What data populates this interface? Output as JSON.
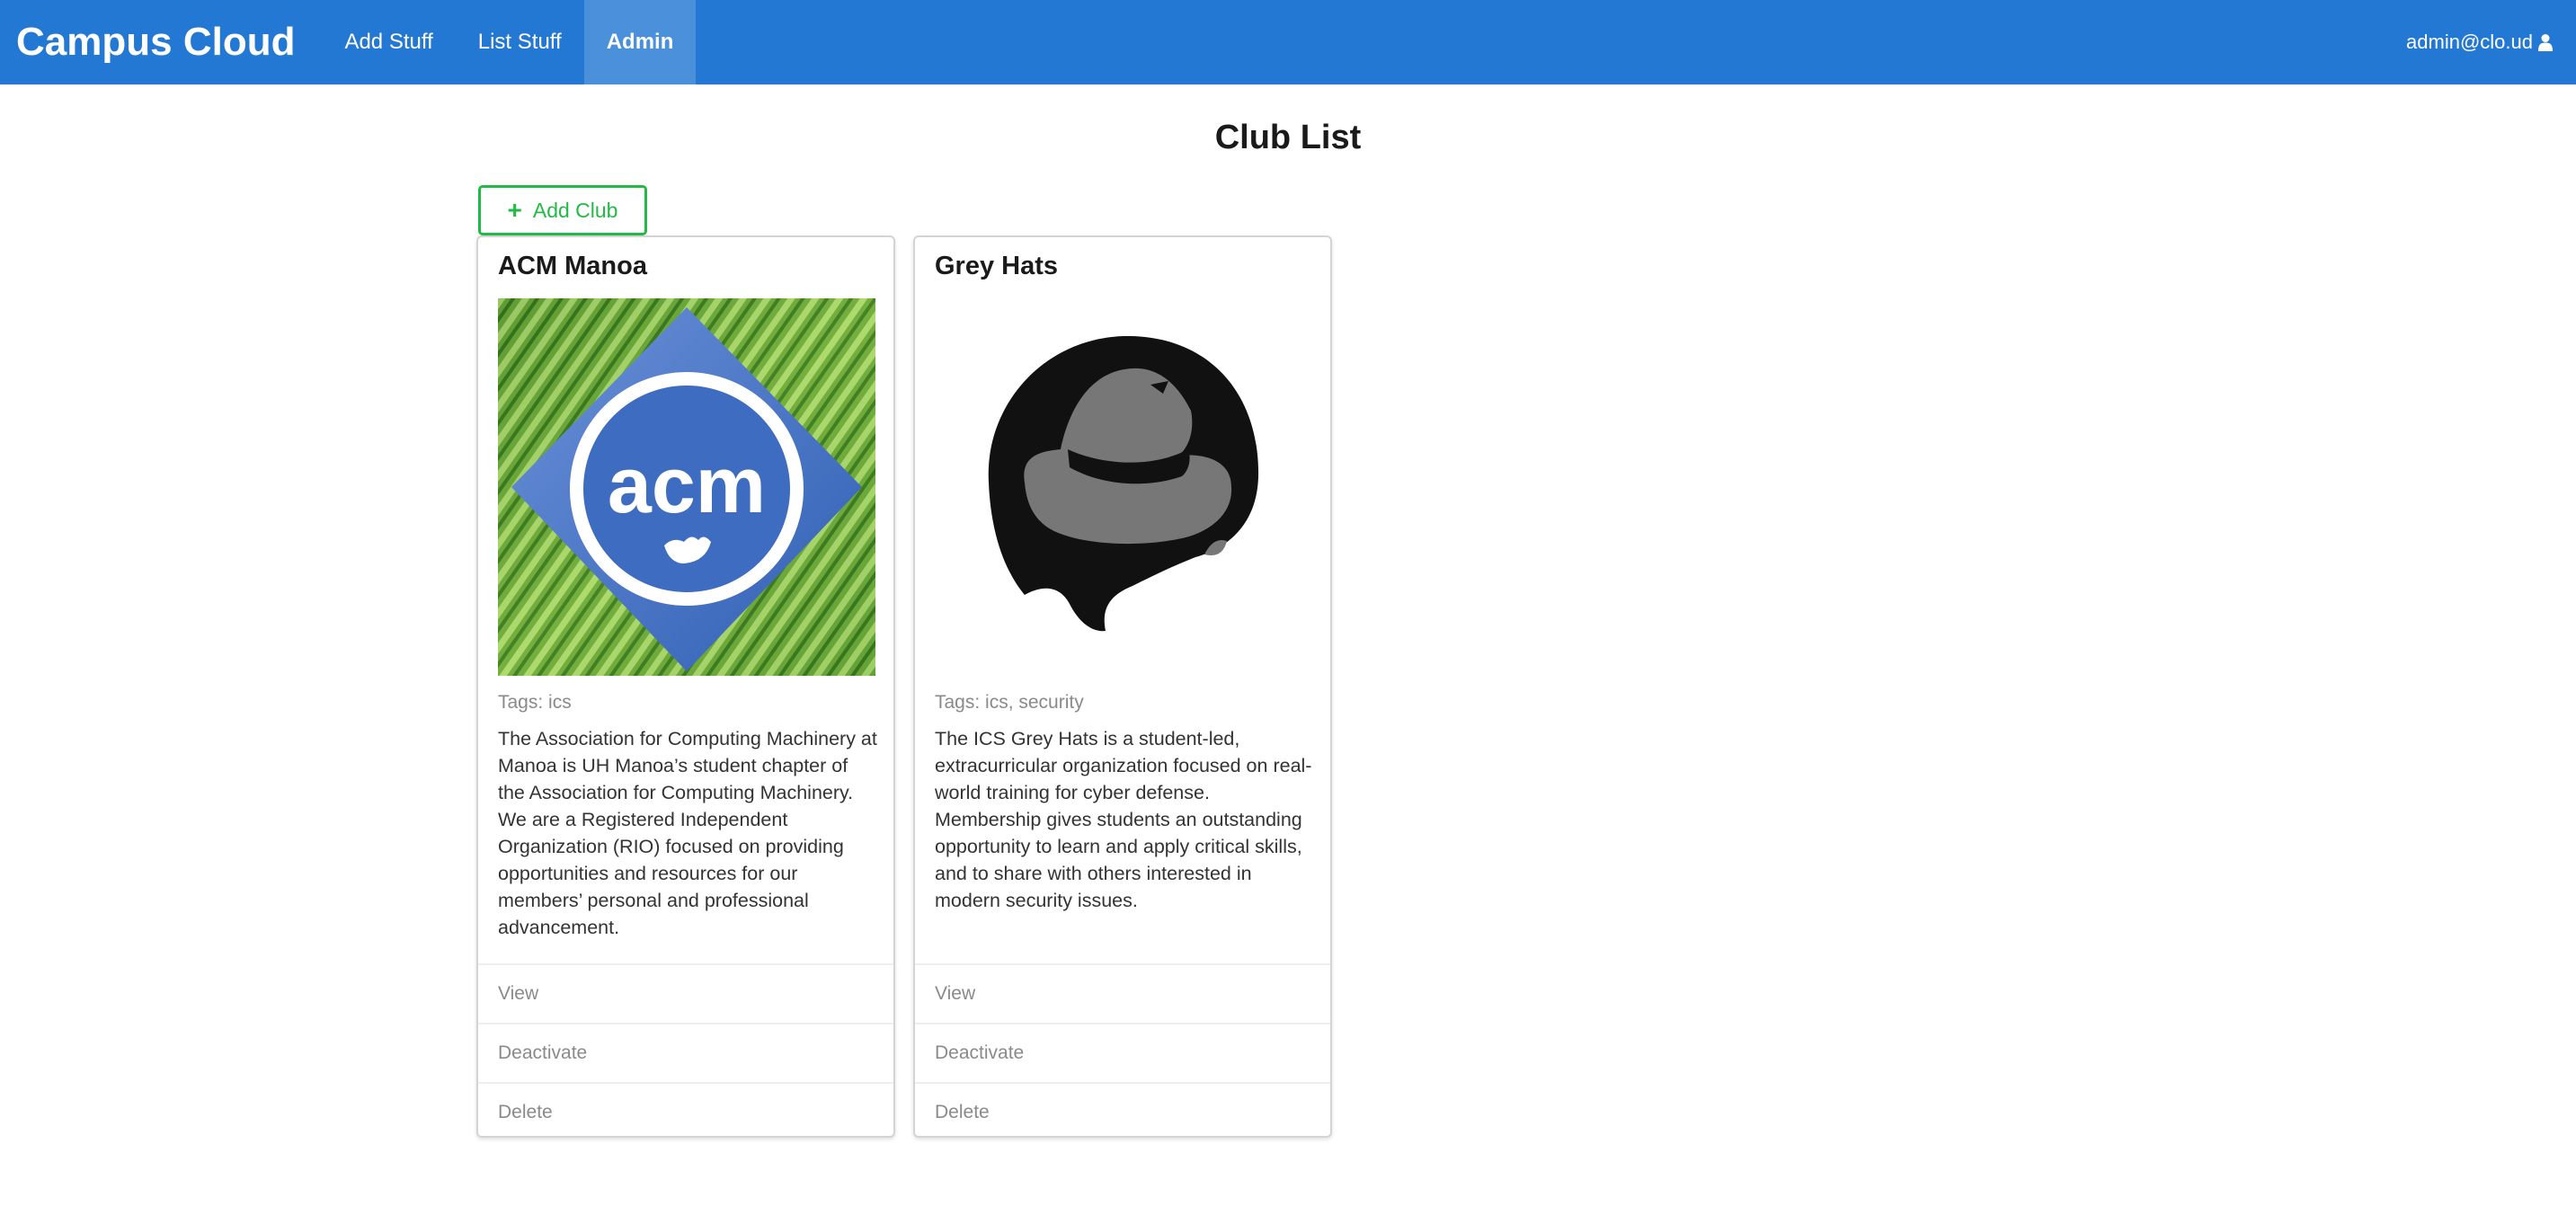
{
  "navbar": {
    "brand": "Campus Cloud",
    "items": [
      {
        "label": "Add Stuff"
      },
      {
        "label": "List Stuff"
      },
      {
        "label": "Admin",
        "active": true
      }
    ],
    "user": "admin@clo.ud",
    "user_icon": "user-icon",
    "color": "#2378d3"
  },
  "page": {
    "title": "Club List",
    "add_button_label": "Add Club",
    "add_icon": "plus-icon",
    "accent": "#21ba45"
  },
  "clubs": [
    {
      "name": "ACM Manoa",
      "image_alt": "ACM Manoa logo",
      "logo_text": "acm",
      "tags": "Tags: ics",
      "description": "The Association for Computing Machinery at Manoa is UH Manoa’s student chapter of the Association for Computing Machinery. We are a Registered Independent Organization (RIO) focused on providing opportunities and resources for our members’ personal and professional advancement.",
      "actions": [
        "View",
        "Deactivate",
        "Delete"
      ]
    },
    {
      "name": "Grey Hats",
      "image_alt": "Grey Hats logo",
      "tags": "Tags: ics, security",
      "description": "The ICS Grey Hats is a student-led, extracurricular organization focused on real-world training for cyber defense. Membership gives students an outstanding opportunity to learn and apply critical skills, and to share with others interested in modern security issues.",
      "actions": [
        "View",
        "Deactivate",
        "Delete"
      ]
    }
  ]
}
